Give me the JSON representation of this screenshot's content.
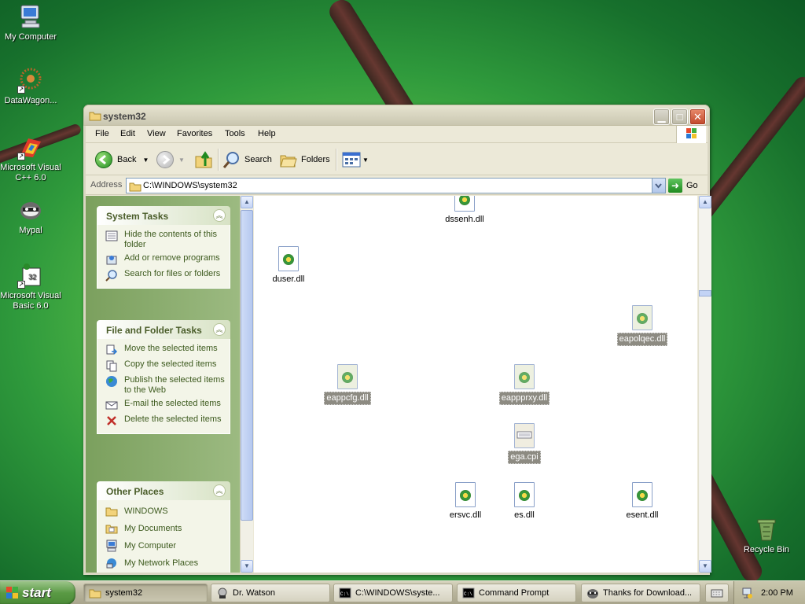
{
  "desktop": {
    "icons": [
      {
        "label": "My Computer",
        "icon": "my-computer-icon"
      },
      {
        "label": "DataWagon...",
        "icon": "datawagon-icon"
      },
      {
        "label": "Microsoft Visual C++ 6.0",
        "icon": "visual-cpp-icon"
      },
      {
        "label": "Mypal",
        "icon": "mypal-icon"
      },
      {
        "label": "Microsoft Visual Basic 6.0",
        "icon": "visual-basic-icon"
      },
      {
        "label": "Recycle Bin",
        "icon": "recycle-bin-icon"
      }
    ]
  },
  "window": {
    "title": "system32",
    "menu": [
      "File",
      "Edit",
      "View",
      "Favorites",
      "Tools",
      "Help"
    ],
    "toolbar": {
      "back": "Back",
      "search": "Search",
      "folders": "Folders"
    },
    "address": {
      "label": "Address",
      "value": "C:\\WINDOWS\\system32",
      "go": "Go"
    },
    "panels": [
      {
        "title": "System Tasks",
        "items": [
          "Hide the contents of this folder",
          "Add or remove programs",
          "Search for files or folders"
        ]
      },
      {
        "title": "File and Folder Tasks",
        "items": [
          "Move the selected items",
          "Copy the selected items",
          "Publish the selected items to the Web",
          "E-mail the selected items",
          "Delete the selected items"
        ]
      },
      {
        "title": "Other Places",
        "items": [
          "WINDOWS",
          "My Documents",
          "My Computer",
          "My Network Places"
        ]
      }
    ],
    "files": [
      {
        "name": "dssenh.dll",
        "selected": false
      },
      {
        "name": "duser.dll",
        "selected": false
      },
      {
        "name": "eapolqec.dll",
        "selected": true
      },
      {
        "name": "eappcfg.dll",
        "selected": true
      },
      {
        "name": "eappprxy.dll",
        "selected": true
      },
      {
        "name": "ega.cpi",
        "selected": true
      },
      {
        "name": "ersvc.dll",
        "selected": false
      },
      {
        "name": "es.dll",
        "selected": false
      },
      {
        "name": "esent.dll",
        "selected": false
      }
    ]
  },
  "taskbar": {
    "start": "start",
    "tasks": [
      "system32",
      "Dr. Watson",
      "C:\\WINDOWS\\syste...",
      "Command Prompt",
      "Thanks for Download..."
    ],
    "clock": "2:00 PM"
  }
}
